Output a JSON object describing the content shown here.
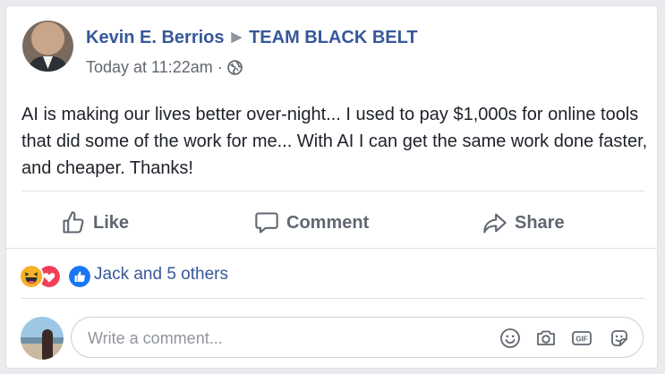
{
  "post": {
    "author": "Kevin E. Berrios",
    "group": "TEAM BLACK BELT",
    "timestamp": "Today at 11:22am",
    "separator": "·",
    "visibility_icon": "globe-icon",
    "text": "AI is making our lives better over-night... I used to pay $1,000s for online tools that did some of the work for me... With AI I can get the same work done faster, and cheaper. Thanks!"
  },
  "actions": {
    "like": "Like",
    "comment": "Comment",
    "share": "Share"
  },
  "reactions": {
    "icons": [
      "haha-icon",
      "love-icon",
      "like-icon"
    ],
    "summary": "Jack and 5 others"
  },
  "comment_box": {
    "placeholder": "Write a comment...",
    "icons": [
      "emoji-icon",
      "camera-icon",
      "gif-icon",
      "sticker-icon"
    ]
  },
  "colors": {
    "link": "#365899",
    "text": "#1d2129",
    "muted": "#606770",
    "like_blue": "#1877f2",
    "love_red": "#f33e58",
    "haha_yellow": "#f7b125"
  }
}
